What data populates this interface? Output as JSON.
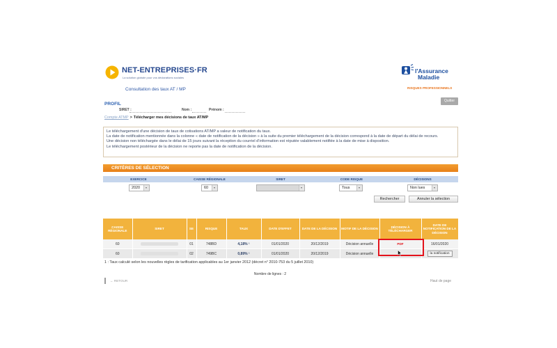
{
  "header": {
    "logo_text": "NET-ENTREPRISES·FR",
    "logo_tagline": "La solution globale pour vos déclarations sociales",
    "service_title": "Consultation des taux AT / MP",
    "partner_line1": "l'Assurance",
    "partner_line2": "Maladie",
    "partner_sub": "RISQUES PROFESSIONNELS"
  },
  "profile": {
    "title": "PROFIL",
    "quit_label": "Quitter",
    "siret_label": "SIRET :",
    "nom_label": "Nom :",
    "prenom_label": "Prénom :"
  },
  "breadcrumb": {
    "root": "Compte ATMP",
    "separator": ">",
    "current": "Télécharger mes décisions de taux AT/MP"
  },
  "info": {
    "lines": [
      "Le téléchargement d'une décision de taux de cotisations AT/MP a valeur de notification du taux.",
      "La date de notification mentionnée dans la colonne « date de notification de la décision » à la suite du premier téléchargement de la décision correspond à la date de départ du délai de recours.",
      "Une décision non téléchargée dans le délai de 15 jours suivant la réception du courriel d'information est réputée valablement notifiée à la date de mise à disposition.",
      "Le téléchargement postérieur de la décision ne reporte pas la date de notification de la décision."
    ]
  },
  "criteria": {
    "title": "CRITÈRES DE SÉLECTION",
    "columns": [
      "EXERCICE",
      "CAISSE RÉGIONALE",
      "SIRET",
      "CODE RISQUE",
      "DÉCISIONS"
    ],
    "values": {
      "exercice": "2020",
      "caisse": "60",
      "code_risque": "Tous",
      "decisions": "Non lues"
    },
    "search_label": "Rechercher",
    "reset_label": "Annuler la sélection"
  },
  "table": {
    "headers": [
      "CAISSE RÉGIONALE",
      "SIRET",
      "SE",
      "RISQUE",
      "TAUX",
      "DATE D'EFFET",
      "DATE DE LA DÉCISION",
      "MOTIF DE LA DÉCISION",
      "DÉCISION À TÉLÉCHARGER",
      "DATE DE NOTIFICATION DE LA DÉCISION"
    ],
    "rows": [
      {
        "caisse": "60",
        "se": "01",
        "risque": "748BD",
        "taux": "4,18% ¹",
        "date_effet": "01/01/2020",
        "date_decision": "20/12/2019",
        "motif": "Décision annuelle",
        "decision": "PDF",
        "notification": "16/01/2020"
      },
      {
        "caisse": "60",
        "se": "02",
        "risque": "749BC",
        "taux": "0,89% ¹",
        "date_effet": "01/01/2020",
        "date_decision": "20/12/2019",
        "motif": "Décision annuelle",
        "notification_button": "la notification"
      }
    ]
  },
  "footnote": "1 : Taux calculé selon les nouvelles règles de tarification applicables au 1er janvier 2012 (décret n° 2010-753 du 5 juillet 2010)",
  "row_count": "Nombre de lignes : 2",
  "nav": {
    "back": "← RETOUR",
    "top": "Haut de page"
  },
  "icons": {
    "logo": "play-circle-icon",
    "partner": "assurance-maladie-icon",
    "select_arrow": "chevron-down-icon",
    "cursor": "mouse-cursor-icon"
  },
  "colors": {
    "brand_blue": "#26488f",
    "logo_yellow": "#f6b400",
    "accent_orange": "#e8801a",
    "table_header": "#f2b33d",
    "criteria_header": "#c6d6ed",
    "highlight_red": "#e3121b"
  }
}
